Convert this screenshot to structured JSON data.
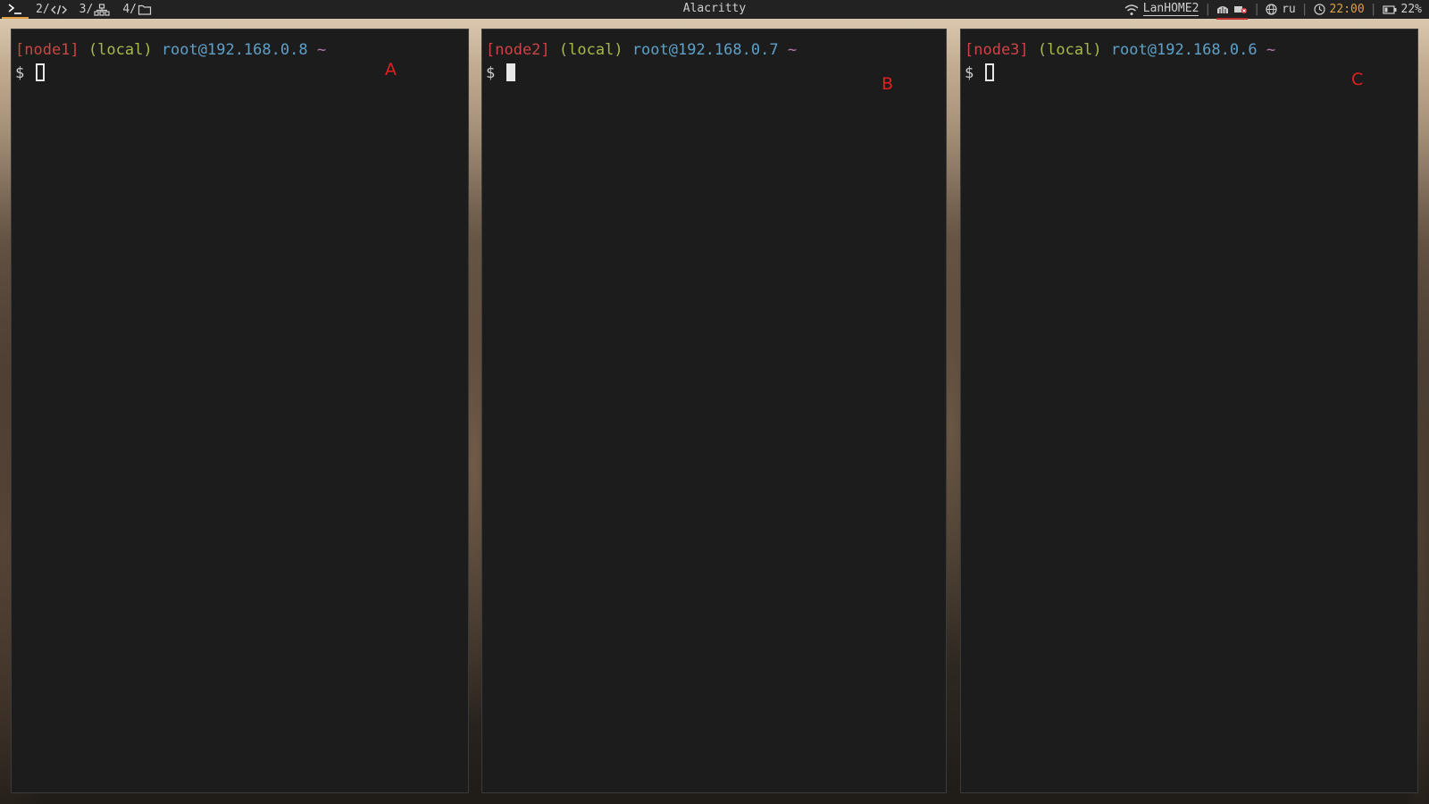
{
  "topbar": {
    "workspaces": [
      {
        "num": "",
        "icon": "terminal-icon",
        "active": true
      },
      {
        "num": "2/",
        "icon": "code-icon",
        "active": false
      },
      {
        "num": "3/",
        "icon": "network-icon",
        "active": false
      },
      {
        "num": "4/",
        "icon": "folder-icon",
        "active": false
      }
    ],
    "window_title": "Alacritty",
    "tray": {
      "wifi_label": "LanHOME2",
      "language": "ru",
      "clock": "22:00",
      "battery": "22%"
    }
  },
  "terminals": [
    {
      "node": "[node1]",
      "scope": "(local)",
      "host": "root@192.168.0.8",
      "cwd": "~",
      "prompt": "$",
      "marker": "A",
      "cursor_filled": false
    },
    {
      "node": "[node2]",
      "scope": "(local)",
      "host": "root@192.168.0.7",
      "cwd": "~",
      "prompt": "$",
      "marker": "B",
      "cursor_filled": true
    },
    {
      "node": "[node3]",
      "scope": "(local)",
      "host": "root@192.168.0.6",
      "cwd": "~",
      "prompt": "$",
      "marker": "C",
      "cursor_filled": false
    }
  ],
  "colors": {
    "node": "#cc4444",
    "local": "#a8b84a",
    "host": "#5ea0c8",
    "tilde": "#b07aa8",
    "marker": "#e02020",
    "clock": "#e0a040"
  }
}
